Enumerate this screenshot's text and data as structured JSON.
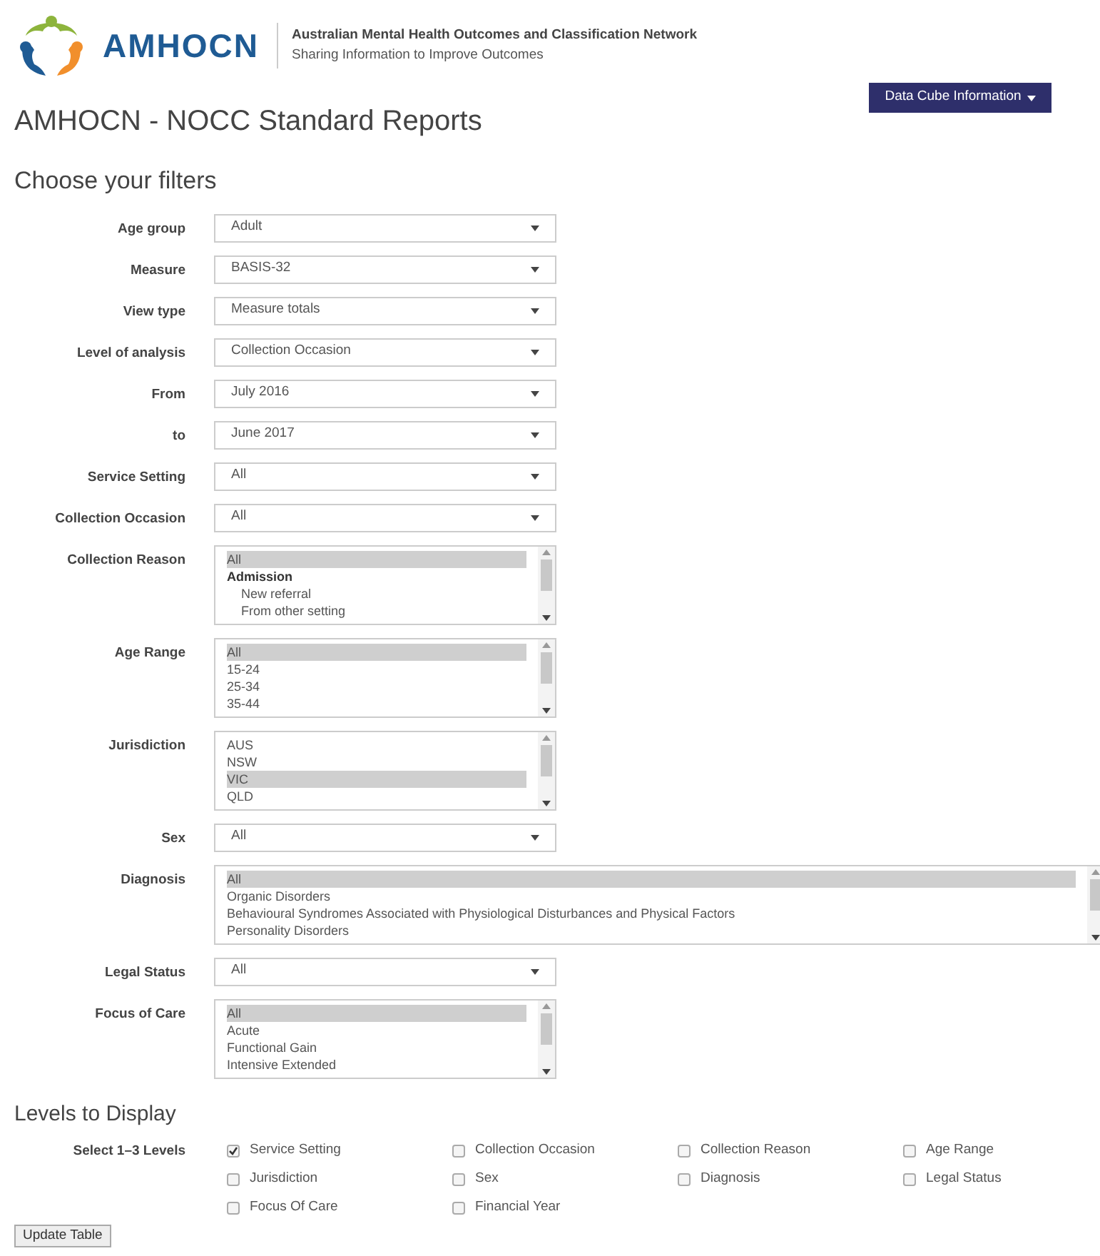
{
  "header": {
    "logo_text": "AMHOCN",
    "org_name": "Australian Mental Health Outcomes and Classification Network",
    "tagline": "Sharing Information to Improve Outcomes"
  },
  "menu_button": "Data Cube Information",
  "title": "AMHOCN - NOCC Standard Reports",
  "filters_heading": "Choose your filters",
  "filters": [
    {
      "label": "Age group",
      "kind": "select",
      "value": "Adult"
    },
    {
      "label": "Measure",
      "kind": "select",
      "value": "BASIS-32"
    },
    {
      "label": "View type",
      "kind": "select",
      "value": "Measure totals"
    },
    {
      "label": "Level of analysis",
      "kind": "select",
      "value": "Collection Occasion"
    },
    {
      "label": "From",
      "kind": "select",
      "value": "July 2016"
    },
    {
      "label": "to",
      "kind": "select",
      "value": "June 2017"
    },
    {
      "label": "Service Setting",
      "kind": "select",
      "value": "All"
    },
    {
      "label": "Collection Occasion",
      "kind": "select",
      "value": "All"
    },
    {
      "label": "Collection Reason",
      "kind": "list",
      "options": [
        {
          "text": "All",
          "kind": "option",
          "selected": true
        },
        {
          "text": "Admission",
          "kind": "group",
          "selected": false
        },
        {
          "text": "New referral",
          "kind": "sub",
          "selected": false
        },
        {
          "text": "From other setting",
          "kind": "sub",
          "selected": false
        }
      ]
    },
    {
      "label": "Age Range",
      "kind": "list",
      "options": [
        {
          "text": "All",
          "kind": "option",
          "selected": true
        },
        {
          "text": "15-24",
          "kind": "option",
          "selected": false
        },
        {
          "text": "25-34",
          "kind": "option",
          "selected": false
        },
        {
          "text": "35-44",
          "kind": "option",
          "selected": false
        }
      ]
    },
    {
      "label": "Jurisdiction",
      "kind": "list",
      "options": [
        {
          "text": "AUS",
          "kind": "option",
          "selected": false
        },
        {
          "text": "NSW",
          "kind": "option",
          "selected": false
        },
        {
          "text": "VIC",
          "kind": "option",
          "selected": true
        },
        {
          "text": "QLD",
          "kind": "option",
          "selected": false
        }
      ]
    },
    {
      "label": "Sex",
      "kind": "select",
      "value": "All"
    },
    {
      "label": "Diagnosis",
      "kind": "widelist",
      "options": [
        {
          "text": "All",
          "kind": "option",
          "selected": true
        },
        {
          "text": "Organic Disorders",
          "kind": "option",
          "selected": false
        },
        {
          "text": "Behavioural Syndromes Associated with Physiological Disturbances and Physical Factors",
          "kind": "option",
          "selected": false
        },
        {
          "text": "Personality Disorders",
          "kind": "option",
          "selected": false
        }
      ]
    },
    {
      "label": "Legal Status",
      "kind": "select",
      "value": "All"
    },
    {
      "label": "Focus of Care",
      "kind": "list",
      "options": [
        {
          "text": "All",
          "kind": "option",
          "selected": true
        },
        {
          "text": "Acute",
          "kind": "option",
          "selected": false
        },
        {
          "text": "Functional Gain",
          "kind": "option",
          "selected": false
        },
        {
          "text": "Intensive Extended",
          "kind": "option",
          "selected": false
        }
      ]
    }
  ],
  "levels_heading": "Levels to Display",
  "levels_label": "Select 1–3 Levels",
  "levels": [
    {
      "label": "Service Setting",
      "checked": true
    },
    {
      "label": "Collection Occasion",
      "checked": false
    },
    {
      "label": "Collection Reason",
      "checked": false
    },
    {
      "label": "Age Range",
      "checked": false
    },
    {
      "label": "Jurisdiction",
      "checked": false
    },
    {
      "label": "Sex",
      "checked": false
    },
    {
      "label": "Diagnosis",
      "checked": false
    },
    {
      "label": "Legal Status",
      "checked": false
    },
    {
      "label": "Focus Of Care",
      "checked": false
    },
    {
      "label": "Financial Year",
      "checked": false
    }
  ],
  "update_button": "Update Table"
}
